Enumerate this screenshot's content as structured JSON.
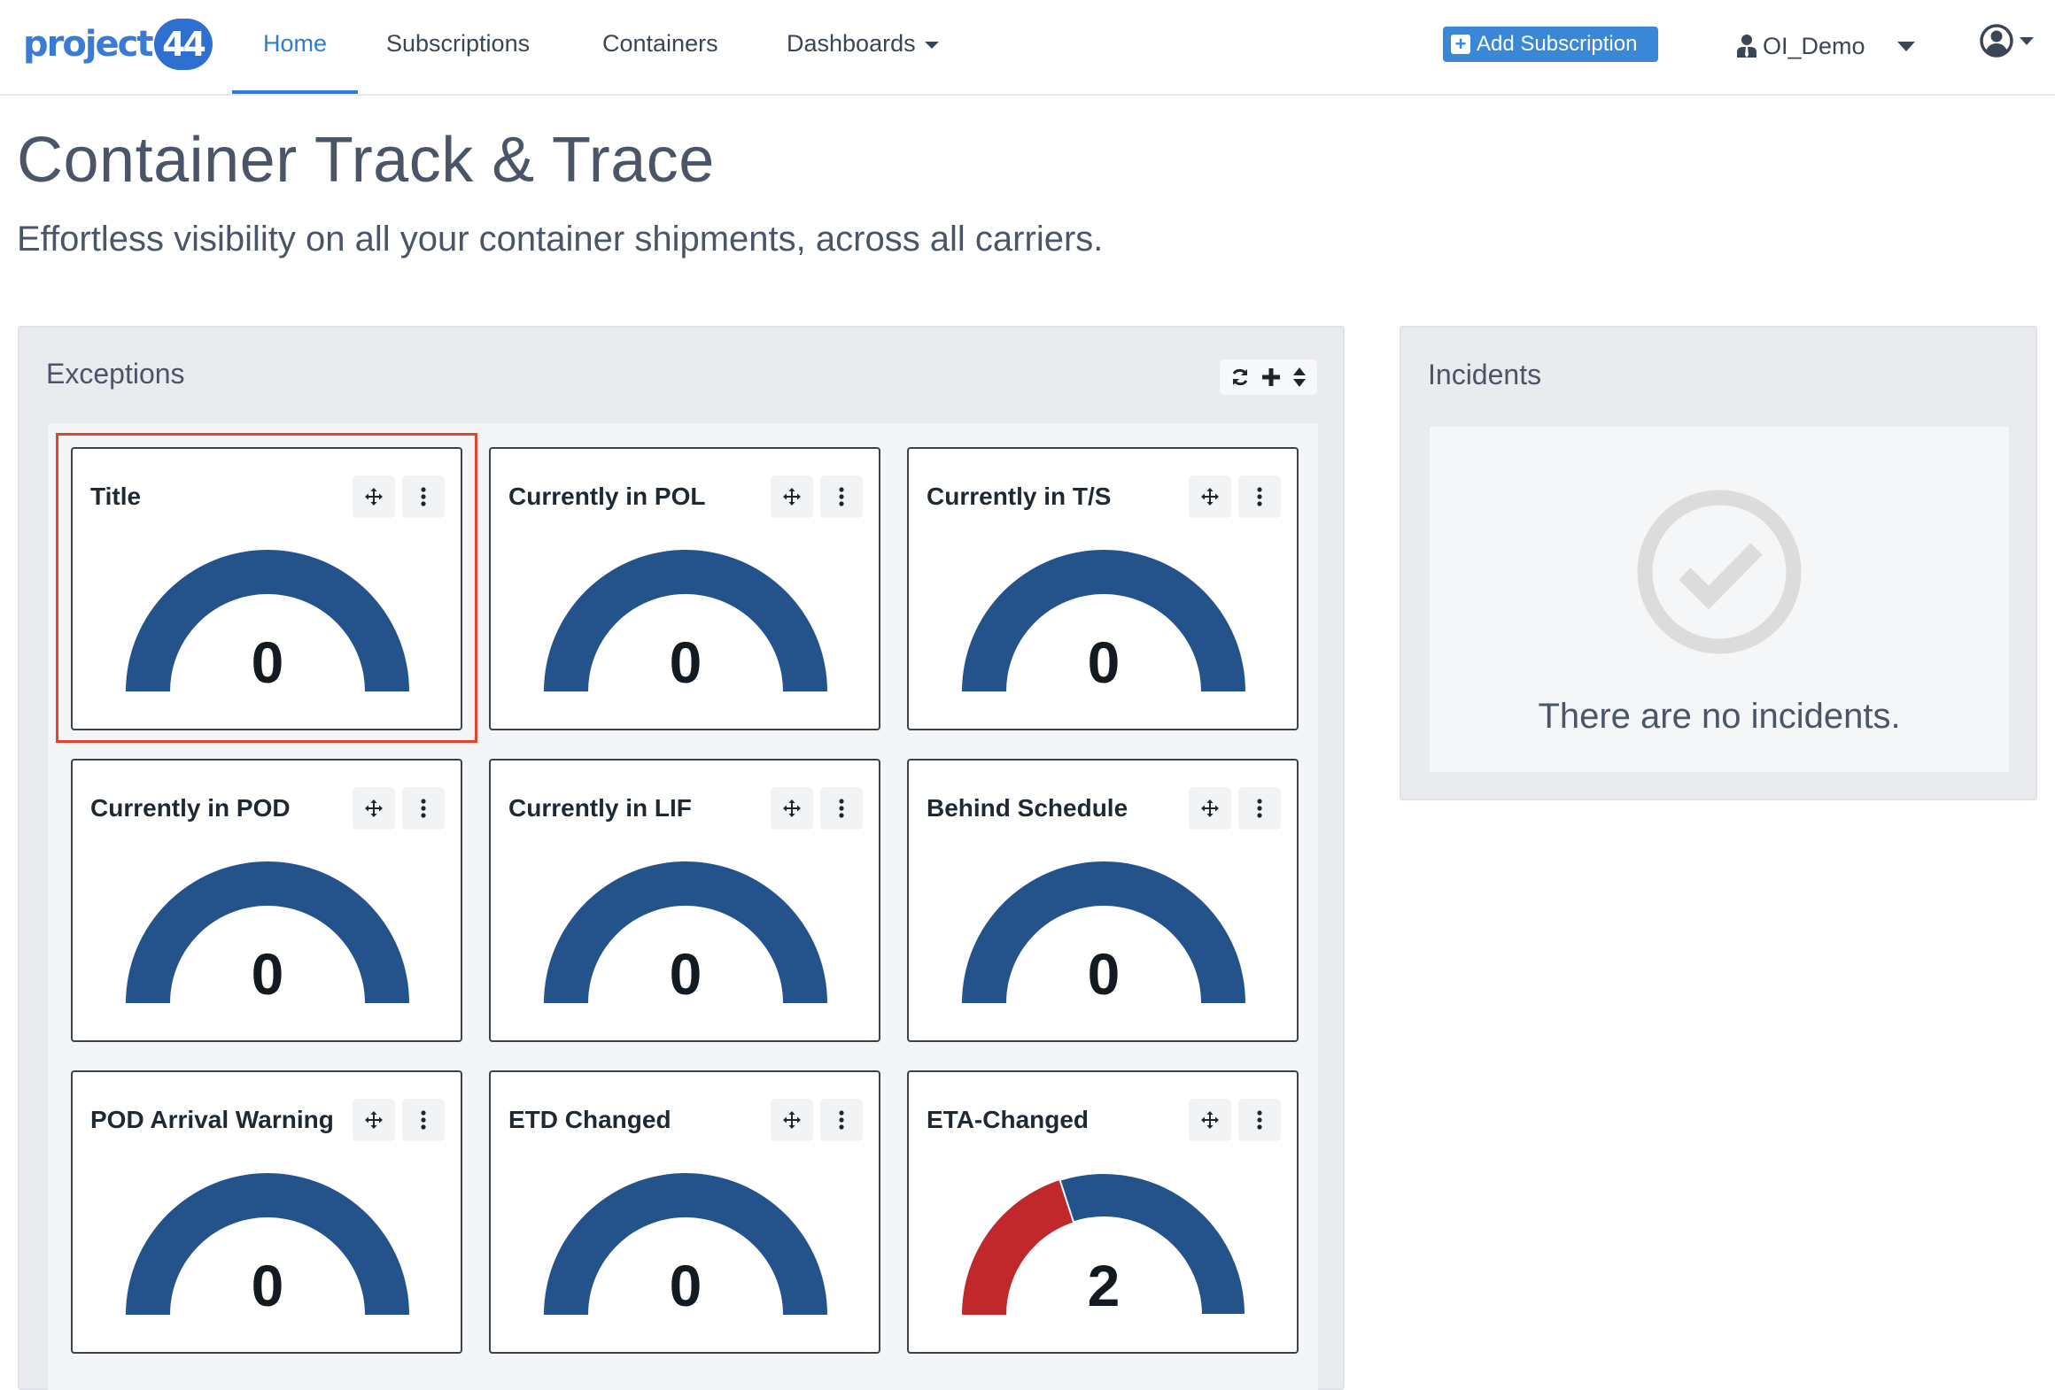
{
  "nav": {
    "logo_text": "project",
    "logo_badge": "44",
    "items": [
      {
        "label": "Home",
        "active": true
      },
      {
        "label": "Subscriptions",
        "active": false
      },
      {
        "label": "Containers",
        "active": false
      },
      {
        "label": "Dashboards",
        "active": false,
        "dropdown": true
      }
    ],
    "add_button": "Add Subscription",
    "org": "OI_Demo",
    "account_icon": "user-circle-icon"
  },
  "header": {
    "title": "Container Track & Trace",
    "subtitle": "Effortless visibility on all your container shipments, across all carriers."
  },
  "exceptions": {
    "title": "Exceptions",
    "tools": [
      "refresh-icon",
      "plus-icon",
      "sort-icon"
    ],
    "widgets": [
      {
        "title": "Title",
        "value": "0",
        "selected": true,
        "exception_fraction": 0
      },
      {
        "title": "Currently in POL",
        "value": "0",
        "exception_fraction": 0
      },
      {
        "title": "Currently in T/S",
        "value": "0",
        "exception_fraction": 0
      },
      {
        "title": "Currently in POD",
        "value": "0",
        "exception_fraction": 0
      },
      {
        "title": "Currently in LIF",
        "value": "0",
        "exception_fraction": 0
      },
      {
        "title": "Behind Schedule",
        "value": "0",
        "exception_fraction": 0
      },
      {
        "title": "POD Arrival Warning",
        "value": "0",
        "exception_fraction": 0
      },
      {
        "title": "ETD Changed",
        "value": "0",
        "exception_fraction": 0
      },
      {
        "title": "ETA-Changed",
        "value": "2",
        "exception_fraction": 0.4
      }
    ],
    "colors": {
      "gauge_base": "#23538a",
      "gauge_alert": "#c0282c"
    }
  },
  "incidents": {
    "title": "Incidents",
    "empty_message": "There are no incidents.",
    "icon": "check-circle-icon"
  }
}
